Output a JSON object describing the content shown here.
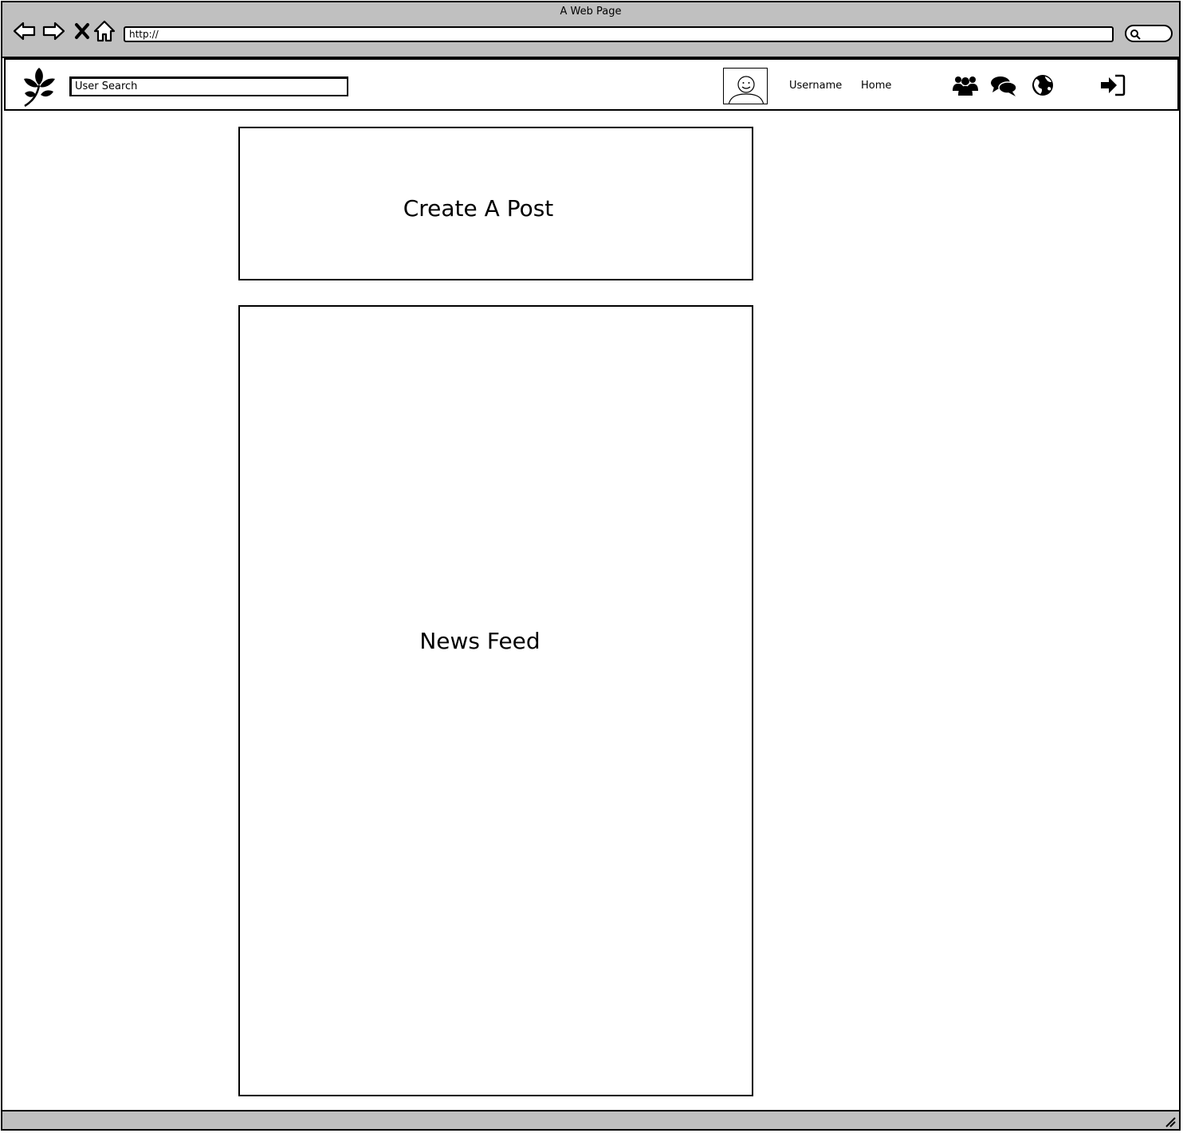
{
  "browser": {
    "title": "A Web Page",
    "url": "http://",
    "back_icon": "back-arrow-icon",
    "forward_icon": "forward-arrow-icon",
    "stop_icon": "close-icon",
    "home_icon": "home-icon",
    "search_icon": "magnifier-icon"
  },
  "header": {
    "logo_icon": "leaf-branch-icon",
    "search_placeholder": "User Search",
    "avatar_icon": "user-avatar-icon",
    "username": "Username",
    "home": "Home",
    "icons": [
      "group-icon",
      "chat-icon",
      "globe-icon",
      "sign-in-icon"
    ]
  },
  "main": {
    "create_post": "Create A Post",
    "news_feed": "News Feed"
  }
}
